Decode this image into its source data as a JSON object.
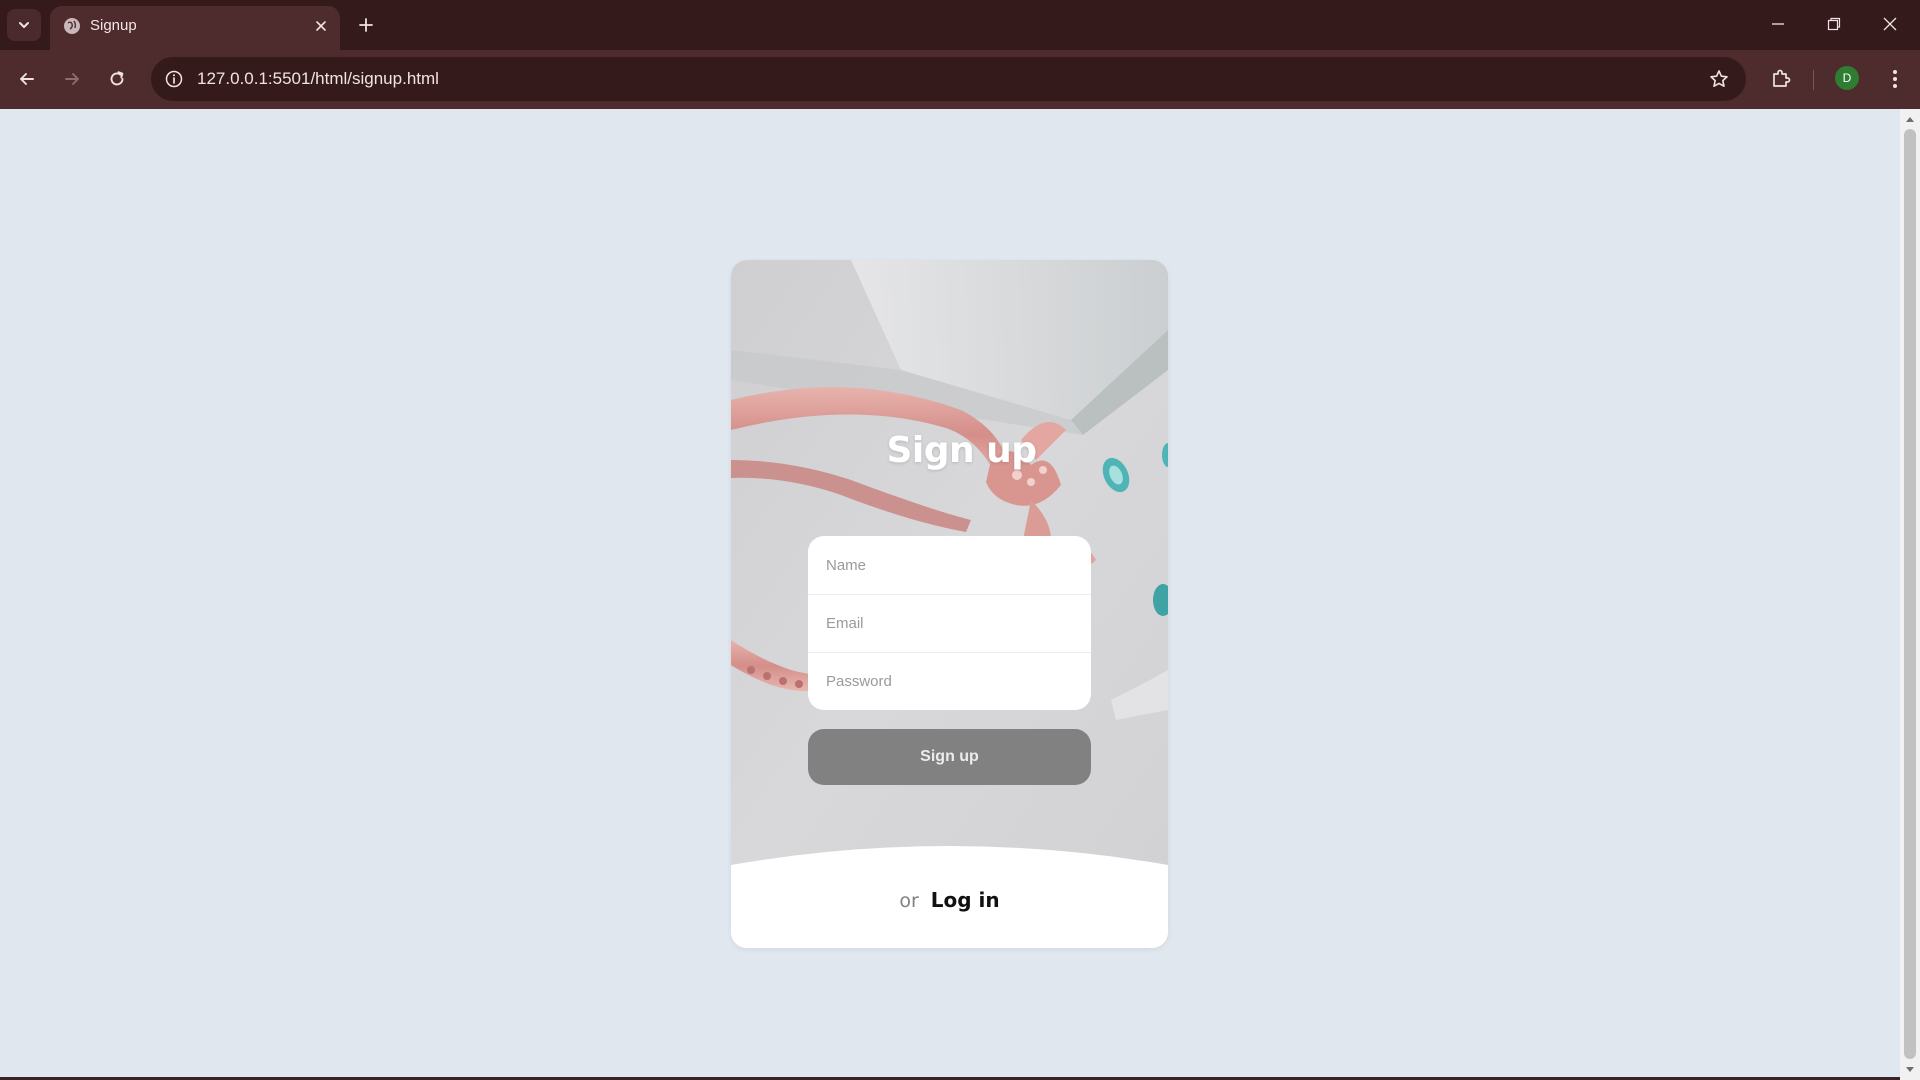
{
  "browser": {
    "tab_title": "Signup",
    "url": "127.0.0.1:5501/html/signup.html",
    "profile_initial": "D",
    "icons": [
      "tab-list-icon",
      "globe-icon",
      "close-icon",
      "plus-icon",
      "minimize-icon",
      "restore-icon",
      "window-close-icon",
      "back-arrow-icon",
      "forward-arrow-icon",
      "reload-icon",
      "info-icon",
      "star-icon",
      "puzzle-icon",
      "kebab-menu-icon"
    ]
  },
  "signup": {
    "title": "Sign up",
    "name_placeholder": "Name",
    "email_placeholder": "Email",
    "password_placeholder": "Password",
    "button_label": "Sign up",
    "or_text": "or",
    "login_label": "Log in"
  },
  "colors": {
    "page_background": "#e0e7ef",
    "chrome_dark": "#351a1c",
    "chrome_toolbar": "#4e2b2d",
    "button_gray": "#818181",
    "ring_rose_gold": "#e2a4a0",
    "gem_teal": "#4fb4b6"
  }
}
